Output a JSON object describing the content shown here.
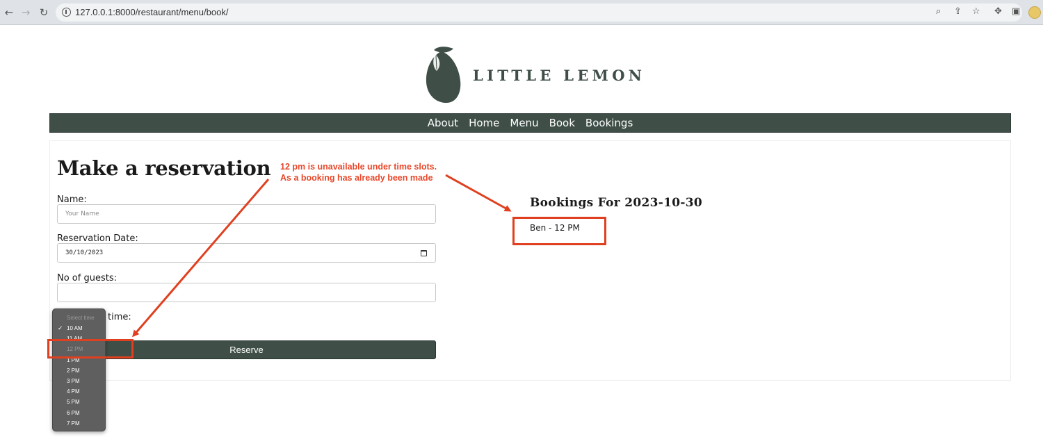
{
  "browser": {
    "url": "127.0.0.1:8000/restaurant/menu/book/"
  },
  "site": {
    "logo_text": "LITTLE LEMON",
    "nav": [
      "About",
      "Home",
      "Menu",
      "Book",
      "Bookings"
    ]
  },
  "form": {
    "title": "Make a reservation",
    "name_label": "Name:",
    "name_placeholder": "Your Name",
    "date_label": "Reservation Date:",
    "date_value": "30/10/2023",
    "guests_label": "No of guests:",
    "guests_value": "",
    "time_label_visible": "time:",
    "reserve_label": "Reserve"
  },
  "time_dropdown": {
    "selected": "10 AM",
    "options": [
      "Select time",
      "10 AM",
      "11 AM",
      "12 PM",
      "1 PM",
      "2 PM",
      "3 PM",
      "4 PM",
      "5 PM",
      "6 PM",
      "7 PM"
    ],
    "disabled": [
      "Select time",
      "12 PM"
    ]
  },
  "bookings": {
    "title": "Bookings For 2023-10-30",
    "items": [
      "Ben - 12 PM"
    ]
  },
  "annotation": {
    "line1": "12 pm is unavailable under time slots.",
    "line2": "As a booking has already been made",
    "color": "#e8472a"
  },
  "colors": {
    "brand": "#3f4f48",
    "annotation": "#e0401f"
  }
}
